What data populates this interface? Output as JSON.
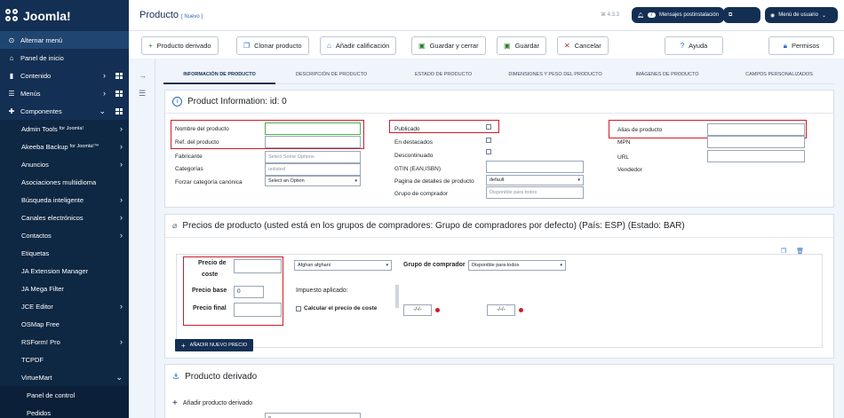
{
  "app": {
    "title": "Joomla!"
  },
  "sidebar": {
    "items": [
      {
        "label": "Alternar menú",
        "icon": "toggle-icon",
        "level": "top"
      },
      {
        "label": "Panel de inicio",
        "icon": "home-icon",
        "level": 0
      },
      {
        "label": "Contenido",
        "icon": "file-icon",
        "level": 0
      },
      {
        "label": "Menús",
        "icon": "list-icon",
        "level": 0
      },
      {
        "label": "Componentes",
        "icon": "puzzle-icon",
        "level": 0
      }
    ],
    "components": [
      {
        "label": "Admin Tools",
        "suffix": "for Joomla!"
      },
      {
        "label": "Akeeba Backup",
        "suffix": "for Joomla!™"
      },
      {
        "label": "Anuncios",
        "suffix": ""
      },
      {
        "label": "Asociaciones multiidioma",
        "suffix": ""
      },
      {
        "label": "Búsqueda inteligente",
        "suffix": ""
      },
      {
        "label": "Canales electrónicos",
        "suffix": ""
      },
      {
        "label": "Contactos",
        "suffix": ""
      },
      {
        "label": "Etiquetas",
        "suffix": ""
      },
      {
        "label": "JA Extension Manager",
        "suffix": ""
      },
      {
        "label": "JA Mega Filter",
        "suffix": ""
      },
      {
        "label": "JCE Editor",
        "suffix": ""
      },
      {
        "label": "OSMap Free",
        "suffix": ""
      },
      {
        "label": "RSForm! Pro",
        "suffix": ""
      },
      {
        "label": "TCPDF",
        "suffix": ""
      },
      {
        "label": "VirtueMart",
        "suffix": ""
      }
    ],
    "virtuemart": [
      "Panel de control",
      "Pedidos"
    ]
  },
  "header": {
    "title": "Producto",
    "status": "[ Nuevo ]",
    "version": "⌘ 4.3.3",
    "messages_count": "7",
    "messages_label": "Mensajes postinstalación",
    "user_label": "Menú de usuario"
  },
  "toolbar": {
    "derived": "Producto derivado",
    "clone": "Clonar producto",
    "rate": "Añadir calificación",
    "save_close": "Guardar y cerrar",
    "save": "Guardar",
    "cancel": "Cancelar",
    "help": "Ayuda",
    "perms": "Permisos"
  },
  "tabs": [
    "INFORMACIÓN DE PRODUCTO",
    "DESCRIPCIÓN DE PRODUCTO",
    "ESTADO DE PRODUCTO",
    "DIMENSIONES Y PESO DEL PRODUCTO",
    "IMÁGENES DE PRODUCTO",
    "CAMPOS PERSONALIZADOS"
  ],
  "info": {
    "title": "Product Information: id: 0",
    "name_label": "Nombre del producto",
    "ref_label": "Ref. del producto",
    "maker_label": "Fabricante",
    "maker_ph": "Select Some Options",
    "cat_label": "Categorías",
    "cat_value": "unlisted",
    "canon_label": "Forzar categoría canónica",
    "canon_value": "Select an Option",
    "pub_label": "Publicado",
    "feat_label": "En destacados",
    "disc_label": "Descontinuado",
    "gtin_label": "GTIN (EAN,ISBN)",
    "page_label": "Pagina de detalles de producto",
    "page_value": "default",
    "group_label": "Grupo de comprador",
    "group_ph": "Disponible para todos",
    "alias_label": "Alias de producto",
    "mpn_label": "MPN",
    "url_label": "URL",
    "vendor_label": "Vendedor"
  },
  "prices": {
    "title": "Precios de producto (usted está en los grupos de compradores: Grupo de compradores por defecto)   (País: ESP)   (Estado: BAR)",
    "cost_label_1": "Precio de",
    "cost_label_2": "coste",
    "base_label": "Precio base",
    "base_value": "0",
    "final_label": "Precio final",
    "currency": "Afghan afghani",
    "group_label": "Grupo de comprador",
    "group_value": "Disponible para todos",
    "tax_label": "Impuesto aplicado:",
    "calc_label": "Calcular el precio de coste",
    "date_from": "-/-/-",
    "date_to": "-/-/-",
    "add_button": "AÑADIR NUEVO PRECIO"
  },
  "derived": {
    "title": "Producto derivado",
    "add_label": "Añadir producto derivado",
    "field_value": "0"
  }
}
